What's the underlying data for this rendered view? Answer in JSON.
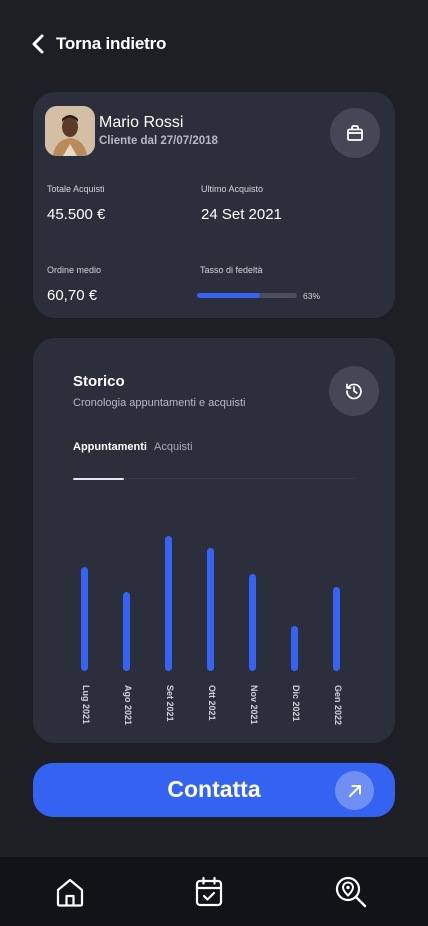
{
  "header": {
    "back_label": "Torna indietro"
  },
  "profile": {
    "name": "Mario Rossi",
    "since": "Cliente dal 27/07/2018",
    "stats": {
      "total_label": "Totale Acquisti",
      "total_value": "45.500 €",
      "last_label": "Ultimo Acquisto",
      "last_value": "24 Set 2021",
      "avg_label": "Ordine medio",
      "avg_value": "60,70 €",
      "loyalty_label": "Tasso di fedeltà",
      "loyalty_pct_text": "63%",
      "loyalty_fraction": 0.63
    }
  },
  "history": {
    "title": "Storico",
    "subtitle": "Cronologia appuntamenti e acquisti",
    "tabs": [
      {
        "label": "Appuntamenti",
        "active": true
      },
      {
        "label": "Acquisti",
        "active": false
      }
    ]
  },
  "chart_data": {
    "type": "bar",
    "categories": [
      "Lug 2021",
      "Ago 2021",
      "Set 2021",
      "Ott 2021",
      "Nov 2021",
      "Dic 2021",
      "Gen 2022"
    ],
    "values": [
      78,
      59,
      101,
      92,
      73,
      34,
      63
    ],
    "ylim": [
      0,
      105
    ],
    "grid": false
  },
  "cta": {
    "label": "Contatta"
  },
  "nav": {
    "items": [
      "home-icon",
      "calendar-check-icon",
      "map-search-icon"
    ]
  },
  "colors": {
    "accent": "#3763f4",
    "background": "#1d1f25",
    "card": "#2b2f3c"
  }
}
